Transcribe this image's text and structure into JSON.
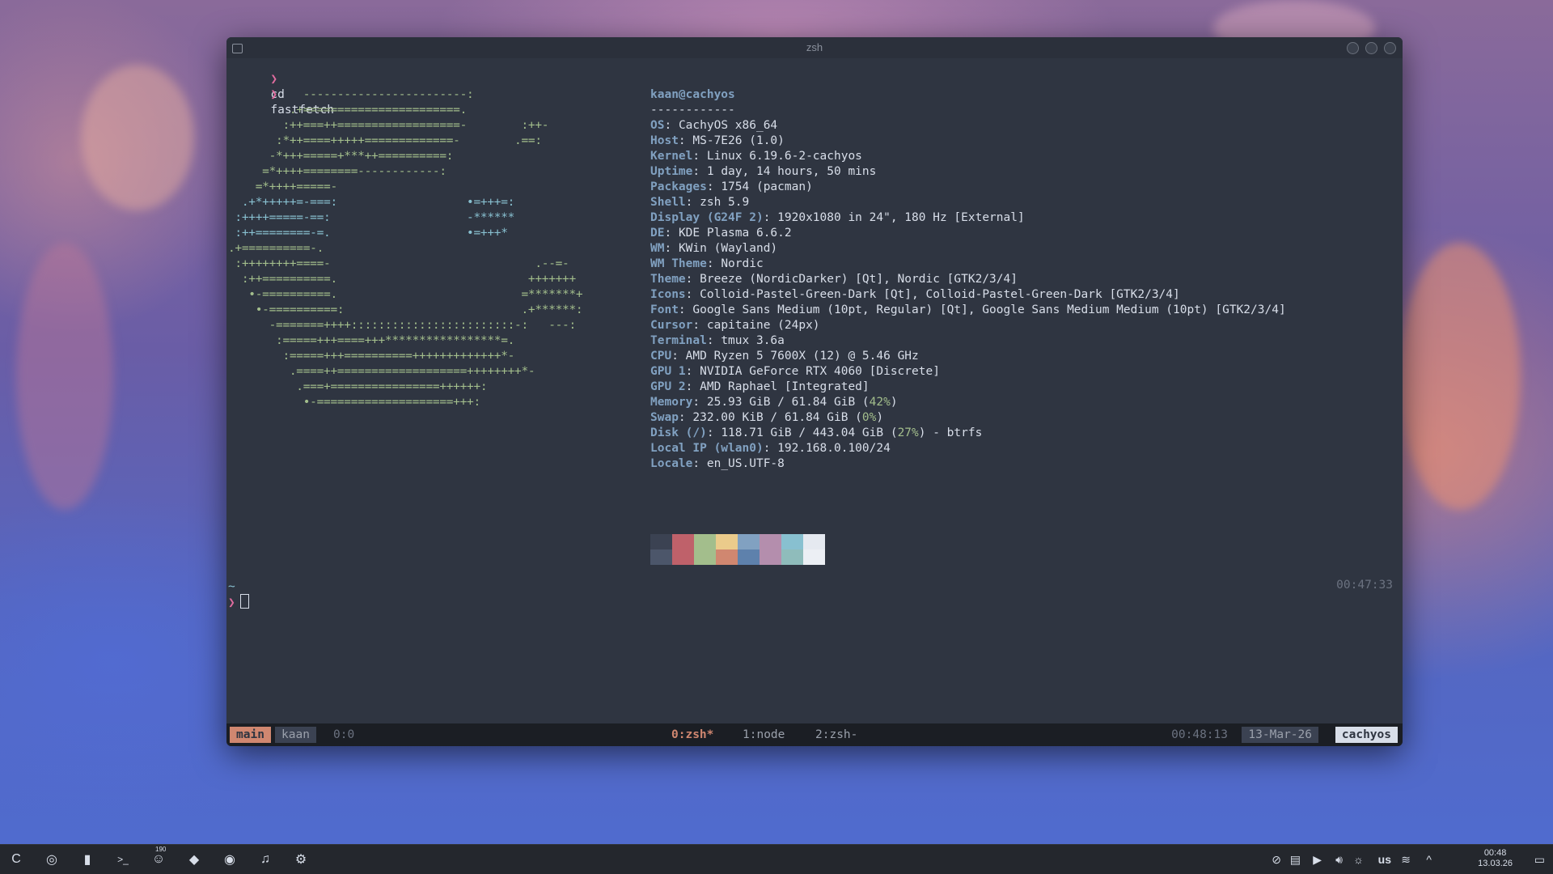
{
  "window": {
    "title": "zsh"
  },
  "session": {
    "history": [
      {
        "prompt": "❯",
        "command": "cd"
      },
      {
        "prompt": "❯",
        "command": "fastfetch"
      }
    ],
    "ascii_logo": [
      "           ------------------------:",
      "         .+=======================.",
      "        :++===++==================-        :++-",
      "       :*++====+++++=============-        .==:",
      "      -*+++=====+***++==========:",
      "     =*++++========------------:",
      "    =*++++=====-",
      "  .+*+++++=-===:                   •=+++=:",
      " :++++=====-==:                    -******",
      " :++========-=.                    •=+++*",
      ".+==========-.",
      " :++++++++====-                              .--=-",
      "  :++==========.                            +++++++",
      "   •-==========.                           =*******+",
      "    •-==========:                          .+******:",
      "      -=======++++::::::::::::::::::::::::-:   ---:",
      "       :=====+++====+++*****************=.",
      "        :=====+++==========+++++++++++++*-",
      "         .====++===================++++++++*-",
      "          .===+================++++++:",
      "           •-====================+++:"
    ],
    "fetch": {
      "user_host": "kaan@cachyos",
      "separator": "------------",
      "rows": [
        {
          "key": "OS",
          "value": "CachyOS x86_64"
        },
        {
          "key": "Host",
          "value": "MS-7E26 (1.0)"
        },
        {
          "key": "Kernel",
          "value": "Linux 6.19.6-2-cachyos"
        },
        {
          "key": "Uptime",
          "value": "1 day, 14 hours, 50 mins"
        },
        {
          "key": "Packages",
          "value": "1754 (pacman)"
        },
        {
          "key": "Shell",
          "value": "zsh 5.9"
        },
        {
          "key": "Display (G24F 2)",
          "value": "1920x1080 in 24\", 180 Hz [External]"
        },
        {
          "key": "DE",
          "value": "KDE Plasma 6.6.2"
        },
        {
          "key": "WM",
          "value": "KWin (Wayland)"
        },
        {
          "key": "WM Theme",
          "value": "Nordic"
        },
        {
          "key": "Theme",
          "value": "Breeze (NordicDarker) [Qt], Nordic [GTK2/3/4]"
        },
        {
          "key": "Icons",
          "value": "Colloid-Pastel-Green-Dark [Qt], Colloid-Pastel-Green-Dark [GTK2/3/4]"
        },
        {
          "key": "Font",
          "value": "Google Sans Medium (10pt, Regular) [Qt], Google Sans Medium Medium (10pt) [GTK2/3/4]"
        },
        {
          "key": "Cursor",
          "value": "capitaine (24px)"
        },
        {
          "key": "Terminal",
          "value": "tmux 3.6a"
        },
        {
          "key": "CPU",
          "value": "AMD Ryzen 5 7600X (12) @ 5.46 GHz"
        },
        {
          "key": "GPU 1",
          "value": "NVIDIA GeForce RTX 4060 [Discrete]"
        },
        {
          "key": "GPU 2",
          "value": "AMD Raphael [Integrated]"
        },
        {
          "key": "Memory",
          "value": "25.93 GiB / 61.84 GiB (",
          "pct": "42%",
          "suffix": ")"
        },
        {
          "key": "Swap",
          "value": "232.00 KiB / 61.84 GiB (",
          "pct": "0%",
          "suffix": ")"
        },
        {
          "key": "Disk (/)",
          "value": "118.71 GiB / 443.04 GiB (",
          "pct": "27%",
          "suffix": ") - btrfs"
        },
        {
          "key": "Local IP (wlan0)",
          "value": "192.168.0.100/24"
        },
        {
          "key": "Locale",
          "value": "en_US.UTF-8"
        }
      ],
      "palette_top": [
        "#3b4252",
        "#bf616a",
        "#a3be8c",
        "#ebcb8b",
        "#81a1c1",
        "#b48ead",
        "#88c0d0",
        "#e5e9f0"
      ],
      "palette_bottom": [
        "#4c566a",
        "#bf616a",
        "#a3be8c",
        "#d08770",
        "#5e81ac",
        "#b48ead",
        "#8fbcbb",
        "#eceff4"
      ]
    },
    "cwd": "~",
    "prompt": "❯",
    "right_time": "00:47:33"
  },
  "tmux": {
    "session": "main",
    "user": "kaan",
    "pane": "0:0",
    "windows": [
      "0:zsh*",
      "1:node",
      "2:zsh-"
    ],
    "time": "00:48:13",
    "date": "13-Mar-26",
    "host": "cachyos"
  },
  "taskbar": {
    "launchers": [
      {
        "name": "cachyos-launcher-icon",
        "glyph": "C"
      },
      {
        "name": "chromium-icon",
        "glyph": "◎"
      },
      {
        "name": "file-manager-icon",
        "glyph": "▮"
      },
      {
        "name": "terminal-icon",
        "glyph": ">_"
      },
      {
        "name": "discord-icon",
        "glyph": "☺"
      },
      {
        "name": "vscode-icon",
        "glyph": "◆"
      },
      {
        "name": "obs-icon",
        "glyph": "◉"
      },
      {
        "name": "spotify-icon",
        "glyph": "♫"
      },
      {
        "name": "steam-icon",
        "glyph": "⚙"
      }
    ],
    "discord_badge": "190",
    "keyboard_layout": "us",
    "clock_time": "00:48",
    "clock_date": "13.03.26"
  },
  "colors": {
    "accent": "#d08770",
    "frost": "#81a1c1",
    "green": "#a3be8c"
  }
}
